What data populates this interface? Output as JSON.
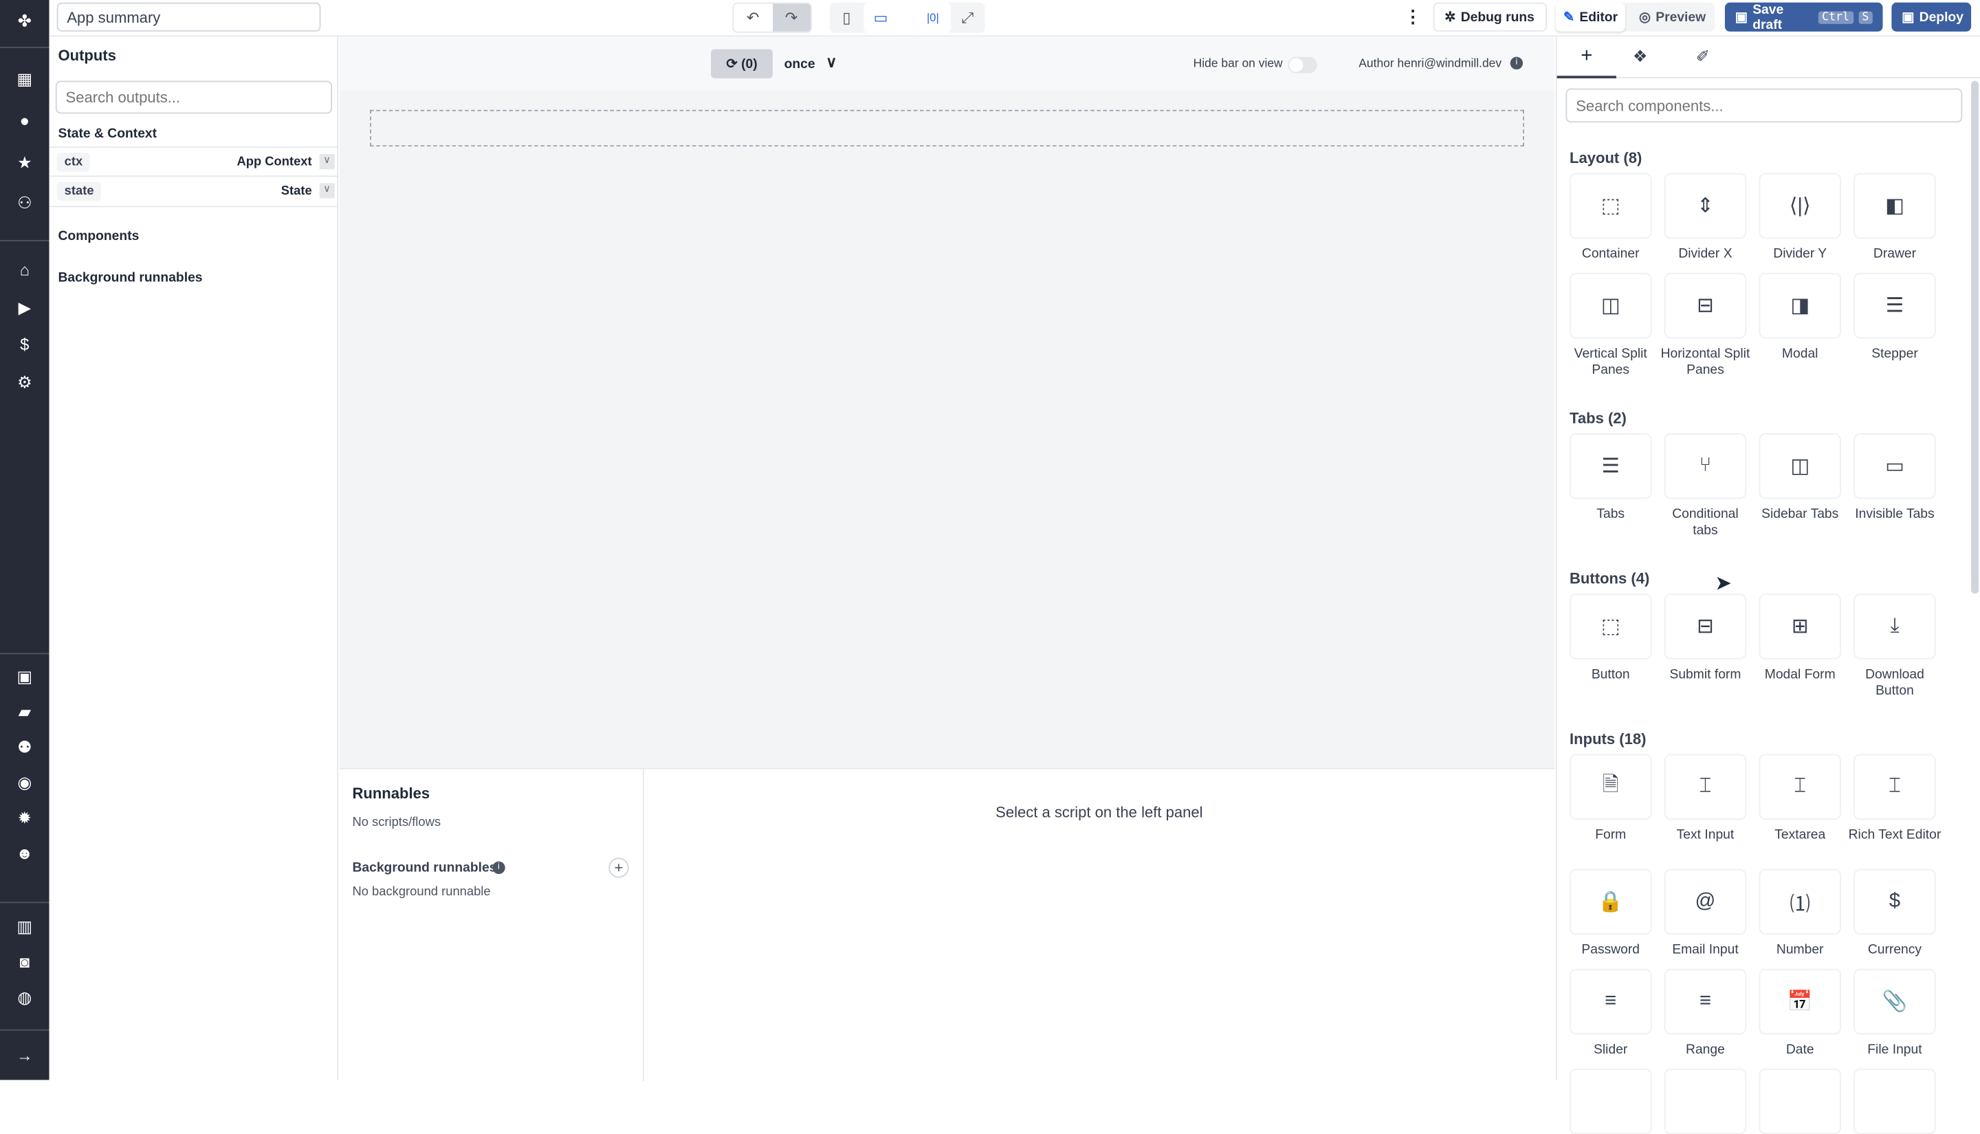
{
  "nav": {
    "icons": [
      "windmill-logo-icon",
      "building-icon",
      "user-icon",
      "star-icon",
      "users-icon",
      "home-icon",
      "play-icon",
      "dollar-icon",
      "resources-icon",
      "calendar-icon",
      "folder-icon",
      "groups-icon",
      "eye-icon",
      "gear-icon",
      "bot-icon",
      "book-icon",
      "discord-icon",
      "github-icon",
      "arrow-right-icon"
    ]
  },
  "topbar": {
    "title": "App summary",
    "debug_runs": "Debug runs",
    "editor": "Editor",
    "preview": "Preview",
    "save_draft": "Save draft",
    "kbd_ctrl": "Ctrl",
    "kbd_s": "S",
    "deploy": "Deploy",
    "accent": "#3b5fa0"
  },
  "left": {
    "title": "Outputs",
    "search_placeholder": "Search outputs...",
    "state_context": "State & Context",
    "rows": [
      {
        "key": "ctx",
        "value": "App Context"
      },
      {
        "key": "state",
        "value": "State"
      }
    ],
    "components": "Components",
    "background": "Background runnables"
  },
  "canvas": {
    "refresh_count": "(0)",
    "refresh_mode": "once",
    "hide_bar": "Hide bar on view",
    "hide_bar_on": false,
    "author": "Author henri@windmill.dev"
  },
  "runnables": {
    "title": "Runnables",
    "empty": "No scripts/flows",
    "bg_title": "Background runnables",
    "bg_empty": "No background runnable",
    "placeholder": "Select a script on the left panel"
  },
  "right": {
    "search_placeholder": "Search components...",
    "sections": [
      {
        "title": "Layout (8)",
        "items": [
          [
            "Container",
            "⬚"
          ],
          [
            "Divider X",
            "⇕"
          ],
          [
            "Divider Y",
            "⟨|⟩"
          ],
          [
            "Drawer",
            "◧"
          ],
          [
            "Vertical Split Panes",
            "◫"
          ],
          [
            "Horizontal Split Panes",
            "⊟"
          ],
          [
            "Modal",
            "◨"
          ],
          [
            "Stepper",
            "☰"
          ]
        ]
      },
      {
        "title": "Tabs (2)",
        "items": [
          [
            "Tabs",
            "☰"
          ],
          [
            "Conditional tabs",
            "⑂"
          ],
          [
            "Sidebar Tabs",
            "◫"
          ],
          [
            "Invisible Tabs",
            "▭"
          ]
        ]
      },
      {
        "title": "Buttons (4)",
        "items": [
          [
            "Button",
            "⬚"
          ],
          [
            "Submit form",
            "⊟"
          ],
          [
            "Modal Form",
            "⊞"
          ],
          [
            "Download Button",
            "⤓"
          ]
        ]
      },
      {
        "title": "Inputs (18)",
        "items": [
          [
            "Form",
            "🗎"
          ],
          [
            "Text Input",
            "⌶"
          ],
          [
            "Textarea",
            "⌶"
          ],
          [
            "Rich Text Editor",
            "⌶"
          ],
          [
            "Password",
            "🔒"
          ],
          [
            "Email Input",
            "@"
          ],
          [
            "Number",
            "⑴"
          ],
          [
            "Currency",
            "$"
          ],
          [
            "Slider",
            "≡"
          ],
          [
            "Range",
            "≡"
          ],
          [
            "Date",
            "📅"
          ],
          [
            "File Input",
            "📎"
          ]
        ]
      }
    ]
  }
}
